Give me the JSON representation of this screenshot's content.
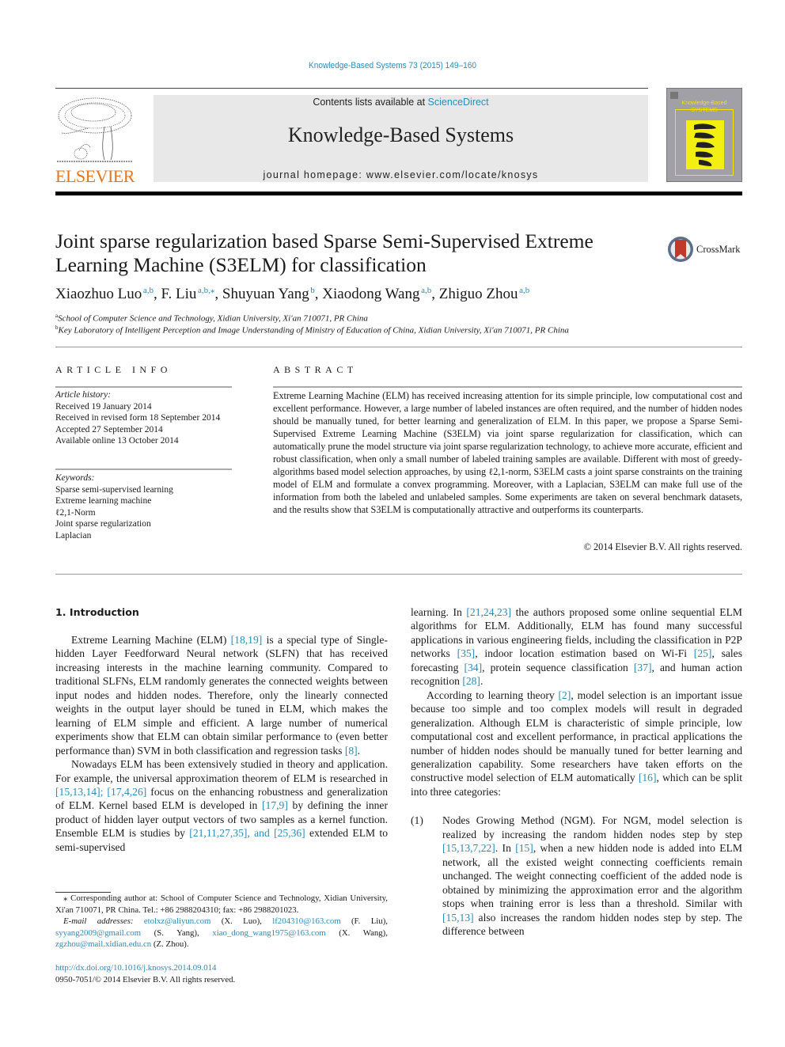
{
  "header": {
    "citation": "Knowledge-Based Systems 73 (2015) 149–160",
    "contents_prefix": "Contents lists available at ",
    "contents_link": "ScienceDirect",
    "journal_name": "Knowledge-Based Systems",
    "homepage": "journal homepage: www.elsevier.com/locate/knosys",
    "publisher_logo": "ELSEVIER",
    "cover_title_1": "Knowledge-Based",
    "cover_title_2": "SYSTEMS",
    "crossmark": "CrossMark",
    "colors": {
      "link": "#2a8bb8",
      "elsevier_orange": "#e8741e",
      "masthead_bg": "#e8e8e8",
      "cover_yellow": "#f4e400"
    }
  },
  "title": {
    "line1": "Joint sparse regularization based Sparse Semi-Supervised Extreme",
    "line2": "Learning Machine (S3ELM) for classification"
  },
  "authors": [
    {
      "name": "Xiaozhuo Luo",
      "affil": "a,b",
      "sep": ", "
    },
    {
      "name": "F. Liu",
      "affil": "a,b,⁎",
      "sep": ", "
    },
    {
      "name": "Shuyuan Yang",
      "affil": "b",
      "sep": ", "
    },
    {
      "name": "Xiaodong Wang",
      "affil": "a,b",
      "sep": ", "
    },
    {
      "name": "Zhiguo Zhou",
      "affil": "a,b",
      "sep": ""
    }
  ],
  "affiliations": [
    {
      "mark": "a",
      "text": "School of Computer Science and Technology, Xidian University, Xi'an 710071, PR China"
    },
    {
      "mark": "b",
      "text": "Key Laboratory of Intelligent Perception and Image Understanding of Ministry of Education of China, Xidian University, Xi'an 710071, PR China"
    }
  ],
  "article_info": {
    "heading": "ARTICLE INFO",
    "history_label": "Article history:",
    "history": [
      "Received 19 January 2014",
      "Received in revised form 18 September 2014",
      "Accepted 27 September 2014",
      "Available online 13 October 2014"
    ],
    "keywords_label": "Keywords:",
    "keywords": [
      "Sparse semi-supervised learning",
      "Extreme learning machine",
      "ℓ2,1-Norm",
      "Joint sparse regularization",
      "Laplacian"
    ]
  },
  "abstract": {
    "heading": "ABSTRACT",
    "text": "Extreme Learning Machine (ELM) has received increasing attention for its simple principle, low computational cost and excellent performance. However, a large number of labeled instances are often required, and the number of hidden nodes should be manually tuned, for better learning and generalization of ELM. In this paper, we propose a Sparse Semi-Supervised Extreme Learning Machine (S3ELM) via joint sparse regularization for classification, which can automatically prune the model structure via joint sparse regularization technology, to achieve more accurate, efficient and robust classification, when only a small number of labeled training samples are available. Different with most of greedy-algorithms based model selection approaches, by using ℓ2,1-norm, S3ELM casts a joint sparse constraints on the training model of ELM and formulate a convex programming. Moreover, with a Laplacian, S3ELM can make full use of the information from both the labeled and unlabeled samples. Some experiments are taken on several benchmark datasets, and the results show that S3ELM is computationally attractive and outperforms its counterparts.",
    "copyright": "© 2014 Elsevier B.V. All rights reserved."
  },
  "introduction": {
    "heading": "1. Introduction",
    "p1": [
      {
        "t": "Extreme Learning Machine (ELM) "
      },
      {
        "ref": "[18,19]"
      },
      {
        "t": " is a special type of Single-hidden Layer Feedforward Neural network (SLFN) that has received increasing interests in the machine learning community. Compared to traditional SLFNs, ELM randomly generates the connected weights between input nodes and hidden nodes. Therefore, only the linearly connected weights in the output layer should be tuned in ELM, which makes the learning of ELM simple and efficient. A large number of numerical experiments show that ELM can obtain similar performance to (even better performance than) SVM in both classification and regression tasks "
      },
      {
        "ref": "[8]"
      },
      {
        "t": "."
      }
    ],
    "p2": [
      {
        "t": "Nowadays ELM has been extensively studied in theory and application. For example, the universal approximation theorem of ELM is researched in "
      },
      {
        "ref": "[15,13,14]; [17,4,26]"
      },
      {
        "t": " focus on the enhancing robustness and generalization of ELM. Kernel based ELM is developed in "
      },
      {
        "ref": "[17,9]"
      },
      {
        "t": " by defining the inner product of hidden layer output vectors of two samples as a kernel function. Ensemble ELM is studies by "
      },
      {
        "ref": "[21,11,27,35], and [25,36]"
      },
      {
        "t": " extended ELM to semi-supervised learning. In "
      },
      {
        "ref": "[21,24,23]"
      },
      {
        "t": " the authors proposed some online sequential ELM algorithms for ELM. Additionally, ELM has found many successful applications in various engineering fields, including the classification in P2P networks "
      },
      {
        "ref": "[35]"
      },
      {
        "t": ", indoor location estimation based on Wi-Fi "
      },
      {
        "ref": "[25]"
      },
      {
        "t": ", sales forecasting "
      },
      {
        "ref": "[34]"
      },
      {
        "t": ", protein sequence classification "
      },
      {
        "ref": "[37]"
      },
      {
        "t": ", and human action recognition "
      },
      {
        "ref": "[28]"
      },
      {
        "t": "."
      }
    ],
    "p3": [
      {
        "t": "According to learning theory "
      },
      {
        "ref": "[2]"
      },
      {
        "t": ", model selection is an important issue because too simple and too complex models will result in degraded generalization. Although ELM is characteristic of simple principle, low computational cost and excellent performance, in practical applications the number of hidden nodes should be manually tuned for better learning and generalization capability. Some researchers have taken efforts on the constructive model selection of ELM automatically "
      },
      {
        "ref": "[16]"
      },
      {
        "t": ", which can be split into three categories:"
      }
    ],
    "list_item_1": {
      "num": "(1)",
      "parts": [
        {
          "t": "Nodes Growing Method (NGM). For NGM, model selection is realized by increasing the random hidden nodes step by step "
        },
        {
          "ref": "[15,13,7,22]"
        },
        {
          "t": ". In "
        },
        {
          "ref": "[15]"
        },
        {
          "t": ", when a new hidden node is added into ELM network, all the existed weight connecting coefficients remain unchanged. The weight connecting coefficient of the added node is obtained by minimizing the approximation error and the algorithm stops when training error is less than a threshold. Similar with "
        },
        {
          "ref": "[15,13]"
        },
        {
          "t": " also increases the random hidden nodes step by step. The difference between"
        }
      ]
    }
  },
  "footnotes": {
    "corresponding": "⁎ Corresponding author at: School of Computer Science and Technology, Xidian University, Xi'an 710071, PR China. Tel.: +86 2988204310; fax: +86 2988201023.",
    "email_label": "E-mail addresses:",
    "emails": [
      {
        "addr": "etolxz@aliyun.com",
        "who": " (X. Luo), "
      },
      {
        "addr": "lf204310@163.com",
        "who": " (F. Liu), "
      },
      {
        "addr": "syyang2009@gmail.com",
        "who": " (S. Yang), "
      },
      {
        "addr": "xiao_dong_wang1975@163.com",
        "who": " (X. Wang), "
      },
      {
        "addr": "zgzhou@mail.xidian.edu.cn",
        "who": " (Z. Zhou)."
      }
    ],
    "doi": "http://dx.doi.org/10.1016/j.knosys.2014.09.014",
    "issn": "0950-7051/© 2014 Elsevier B.V. All rights reserved."
  }
}
